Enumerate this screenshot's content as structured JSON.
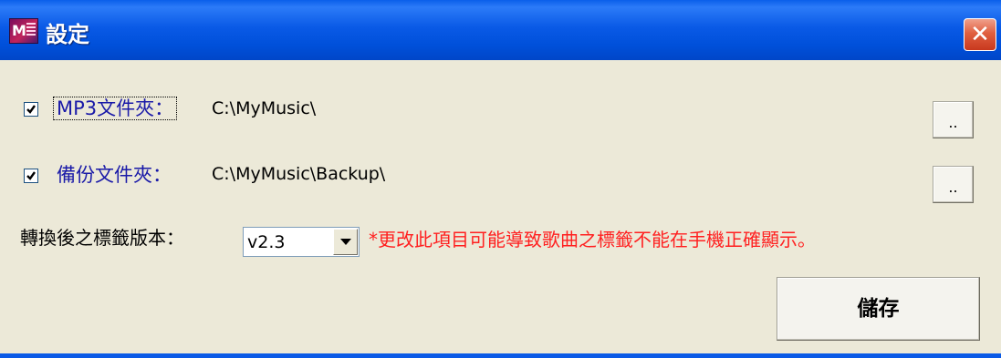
{
  "window": {
    "title": "設定",
    "app_icon": "mp3-app-icon",
    "close_icon": "close-icon"
  },
  "settings": {
    "mp3_folder": {
      "checked": true,
      "label": "MP3文件夾：",
      "path": "C:\\MyMusic\\",
      "browse_label": ".."
    },
    "backup_folder": {
      "checked": true,
      "label": "備份文件夾：",
      "path": "C:\\MyMusic\\Backup\\",
      "browse_label": ".."
    },
    "tag_version": {
      "label": "轉換後之標籤版本：",
      "selected": "v2.3",
      "warning": "*更改此項目可能導致歌曲之標籤不能在手機正確顯示。"
    }
  },
  "actions": {
    "save_label": "儲存"
  },
  "colors": {
    "window_bg": "#ECE9D8",
    "titlebar": "#0A5AE6",
    "label_blue": "#1a1aa8",
    "warning_red": "#FF2020",
    "close_red": "#E06040"
  }
}
